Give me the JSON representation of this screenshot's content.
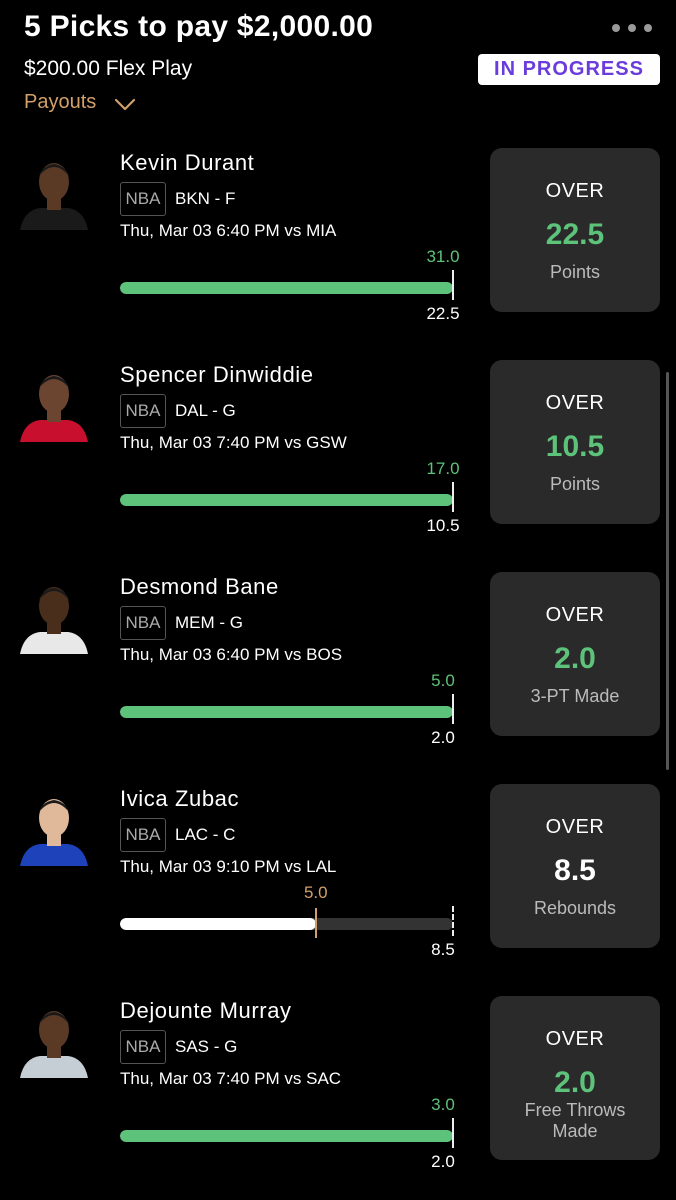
{
  "header": {
    "title": "5 Picks to pay $2,000.00",
    "subtitle": "$200.00 Flex Play",
    "status": "IN PROGRESS",
    "payouts_label": "Payouts"
  },
  "picks": [
    {
      "name": "Kevin Durant",
      "league": "NBA",
      "team": "BKN - F",
      "game": "Thu, Mar 03 6:40 PM  vs MIA",
      "actual": "31.0",
      "line": "22.5",
      "direction": "OVER",
      "stat": "Points",
      "progress": 1.0,
      "state": "hit"
    },
    {
      "name": "Spencer Dinwiddie",
      "league": "NBA",
      "team": "DAL - G",
      "game": "Thu, Mar 03 7:40 PM  vs GSW",
      "actual": "17.0",
      "line": "10.5",
      "direction": "OVER",
      "stat": "Points",
      "progress": 1.0,
      "state": "hit"
    },
    {
      "name": "Desmond Bane",
      "league": "NBA",
      "team": "MEM - G",
      "game": "Thu, Mar 03 6:40 PM  vs BOS",
      "actual": "5.0",
      "line": "2.0",
      "direction": "OVER",
      "stat": "3-PT Made",
      "progress": 1.0,
      "state": "hit"
    },
    {
      "name": "Ivica Zubac",
      "league": "NBA",
      "team": "LAC - C",
      "game": "Thu, Mar 03 9:10 PM  vs LAL",
      "actual": "5.0",
      "line": "8.5",
      "direction": "OVER",
      "stat": "Rebounds",
      "progress": 0.588,
      "state": "pending"
    },
    {
      "name": "Dejounte Murray",
      "league": "NBA",
      "team": "SAS - G",
      "game": "Thu, Mar 03 7:40 PM  vs SAC",
      "actual": "3.0",
      "line": "2.0",
      "direction": "OVER",
      "stat": "Free Throws Made",
      "progress": 1.0,
      "state": "hit"
    }
  ],
  "colors": {
    "background": "#000000",
    "card": "#2a2a2a",
    "hit_green": "#5dc27a",
    "pending_gold": "#d2a06a",
    "status_purple": "#6a3cdc"
  },
  "icons": {
    "more": "more-horizontal-icon",
    "payouts_toggle": "chevron-down-icon",
    "avatar": "player-headshot-icon"
  }
}
